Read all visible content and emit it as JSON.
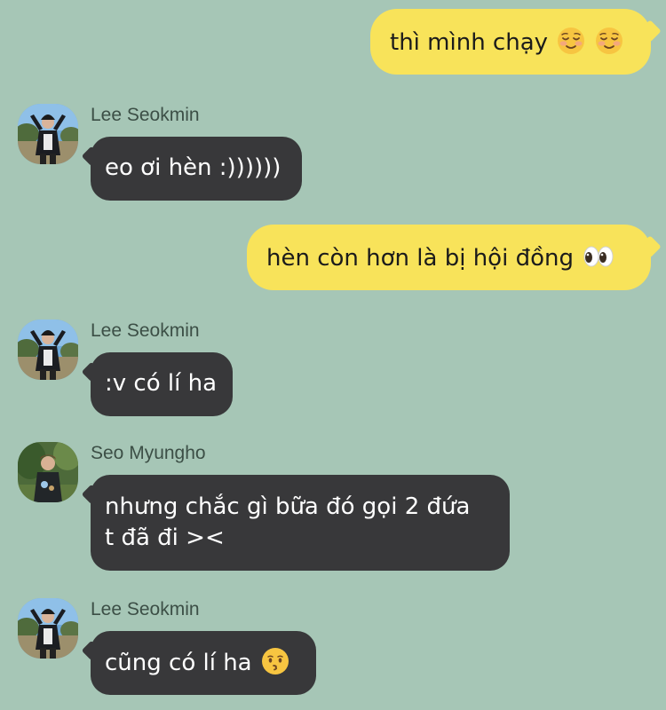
{
  "messages": [
    {
      "type": "outgoing",
      "text": "thì mình chạy",
      "emojis": [
        "relieved-face",
        "relieved-face"
      ]
    },
    {
      "type": "incoming",
      "sender": "Lee Seokmin",
      "text": "eo ơi hèn :))))))"
    },
    {
      "type": "outgoing",
      "text": "hèn còn hơn là bị hội đồng",
      "emojis": [
        "eyes"
      ]
    },
    {
      "type": "incoming",
      "sender": "Lee Seokmin",
      "text": ":v có lí ha"
    },
    {
      "type": "incoming",
      "sender": "Seo Myungho",
      "lines": [
        "nhưng chắc gì bữa đó gọi 2 đứa",
        "t đã đi ><"
      ]
    },
    {
      "type": "incoming",
      "sender": "Lee Seokmin",
      "text": "cũng có lí ha",
      "emojis": [
        "kissing-face"
      ]
    }
  ],
  "colors": {
    "background": "#a6c6b6",
    "outgoing_bubble": "#f8e35a",
    "incoming_bubble": "#38383a",
    "sender_name": "#3c4f46"
  }
}
